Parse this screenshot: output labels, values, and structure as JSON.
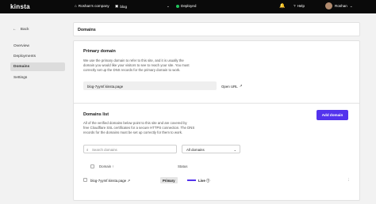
{
  "topbar": {
    "logo": "kinsta",
    "company": "Roshan's company",
    "site": "blog",
    "environment": "Deployed",
    "help": "Help",
    "user": "Roshan",
    "icons": [
      "home-icon",
      "site-icon",
      "bell-icon",
      "help-icon",
      "avatar"
    ],
    "status_color": "#21c55d"
  },
  "sidebar": {
    "back": "Back",
    "items": [
      {
        "label": "Overview"
      },
      {
        "label": "Deployments"
      },
      {
        "label": "Domains",
        "active": true
      },
      {
        "label": "Settings"
      }
    ]
  },
  "page": {
    "title": "Domains"
  },
  "primary": {
    "title": "Primary domain",
    "description_1": "We use the primary domain to refer to this site, and it is usually the",
    "description_2": "domain you would like your visitors to see to reach your site. You must",
    "description_3": "correctly set up the DNS records for the primary domain to work.",
    "url": "blog-7yymf.kinsta.page",
    "open_url": "Open URL"
  },
  "domains": {
    "title": "Domains list",
    "add_button": "Add domain",
    "description_1": "All of the verified domains below point to this site and are covered by",
    "description_2": "free Cloudflare SSL certificates for a secure HTTPS connection. The DNS",
    "description_3": "records for the domains must be set up correctly for them to work.",
    "search_placeholder": "Search domains",
    "filter_value": "All domains",
    "columns": {
      "domain": "Domain",
      "status": "Status"
    },
    "rows": [
      {
        "domain": "blog-7yymf.kinsta.page",
        "badge": "Primary",
        "status": "Live"
      }
    ],
    "accent": "#5333ed"
  }
}
